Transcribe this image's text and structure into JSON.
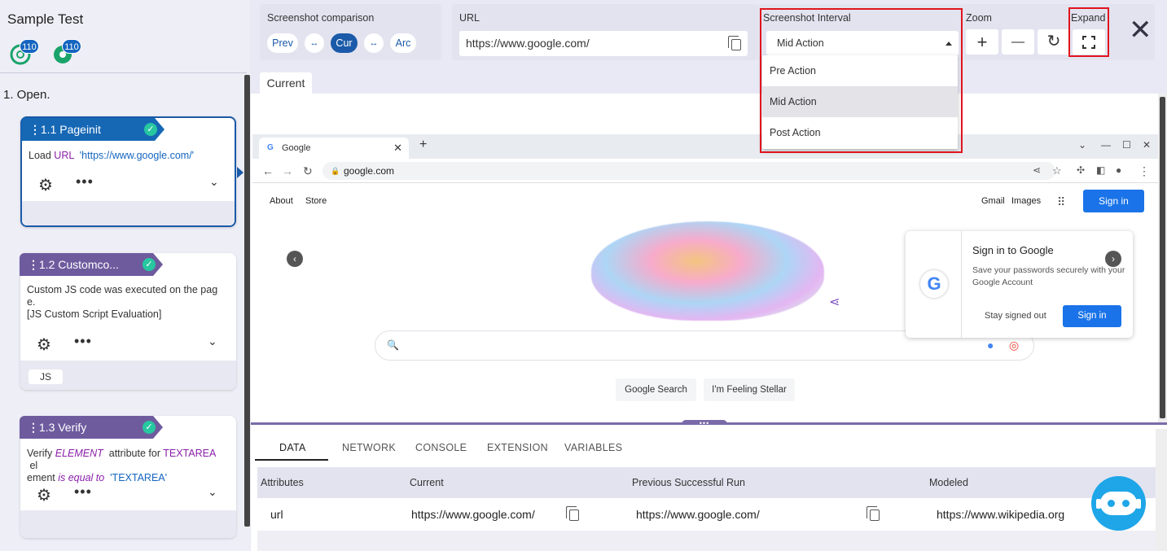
{
  "app": {
    "title": "Sample Test",
    "badge_1": "110",
    "badge_2": "110"
  },
  "section": {
    "title": "1. Open."
  },
  "steps": [
    {
      "label": "1.1 Pageinit",
      "line1_prefix": "Load",
      "line1_kw": "URL",
      "line1_str": "'https://www.google.com/'"
    },
    {
      "label": "1.2 Customco...",
      "line1": "Custom JS code was executed on the pag",
      "line2": "e.",
      "line3": "[JS Custom Script Evaluation]",
      "chip": "JS"
    },
    {
      "label": "1.3 Verify",
      "p1": "Verify",
      "k1": "ELEMENT",
      "p2": "attribute for",
      "k2": "TEXTAREA",
      "p3": "el",
      "p4": "ement",
      "k3": "is equal to",
      "s1": "'TEXTAREA'"
    }
  ],
  "toolbar": {
    "comparison_label": "Screenshot comparison",
    "prev": "Prev",
    "cur": "Cur",
    "arc": "Arc",
    "swap": "↔",
    "url_label": "URL",
    "url_value": "https://www.google.com/",
    "interval_label": "Screenshot Interval",
    "interval_selected": "Mid Action",
    "interval_options": [
      "Pre Action",
      "Mid Action",
      "Post Action"
    ],
    "zoom_label": "Zoom",
    "zoom_in": "+",
    "zoom_out": "—",
    "zoom_reset": "↻",
    "expand_label": "Expand",
    "expand_icon": "⛶",
    "close": "✕"
  },
  "preview": {
    "tab_label": "Current",
    "browser_tab": "Google",
    "browser_url": "google.com",
    "links": {
      "about": "About",
      "store": "Store",
      "gmail": "Gmail",
      "images": "Images"
    },
    "sign_in": "Sign in",
    "search_button": "Google Search",
    "lucky_button": "I'm Feeling Stellar",
    "popup": {
      "title": "Sign in to Google",
      "text": "Save your passwords securely with your Google Account",
      "stay": "Stay signed out",
      "signin": "Sign in"
    }
  },
  "bottom": {
    "tabs": [
      "DATA",
      "NETWORK",
      "CONSOLE",
      "EXTENSION",
      "VARIABLES"
    ],
    "headers": [
      "Attributes",
      "Current",
      "Previous Successful Run",
      "Modeled"
    ],
    "row": {
      "attribute": "url",
      "current": "https://www.google.com/",
      "previous": "https://www.google.com/",
      "modeled": "https://www.wikipedia.org"
    }
  },
  "colors": {
    "accent_blue": "#1a5aa8",
    "step_purple": "#6e5b9e",
    "highlight_red": "#e0141d",
    "check_green": "#27c7a0",
    "chatbot": "#1ea6e8"
  }
}
